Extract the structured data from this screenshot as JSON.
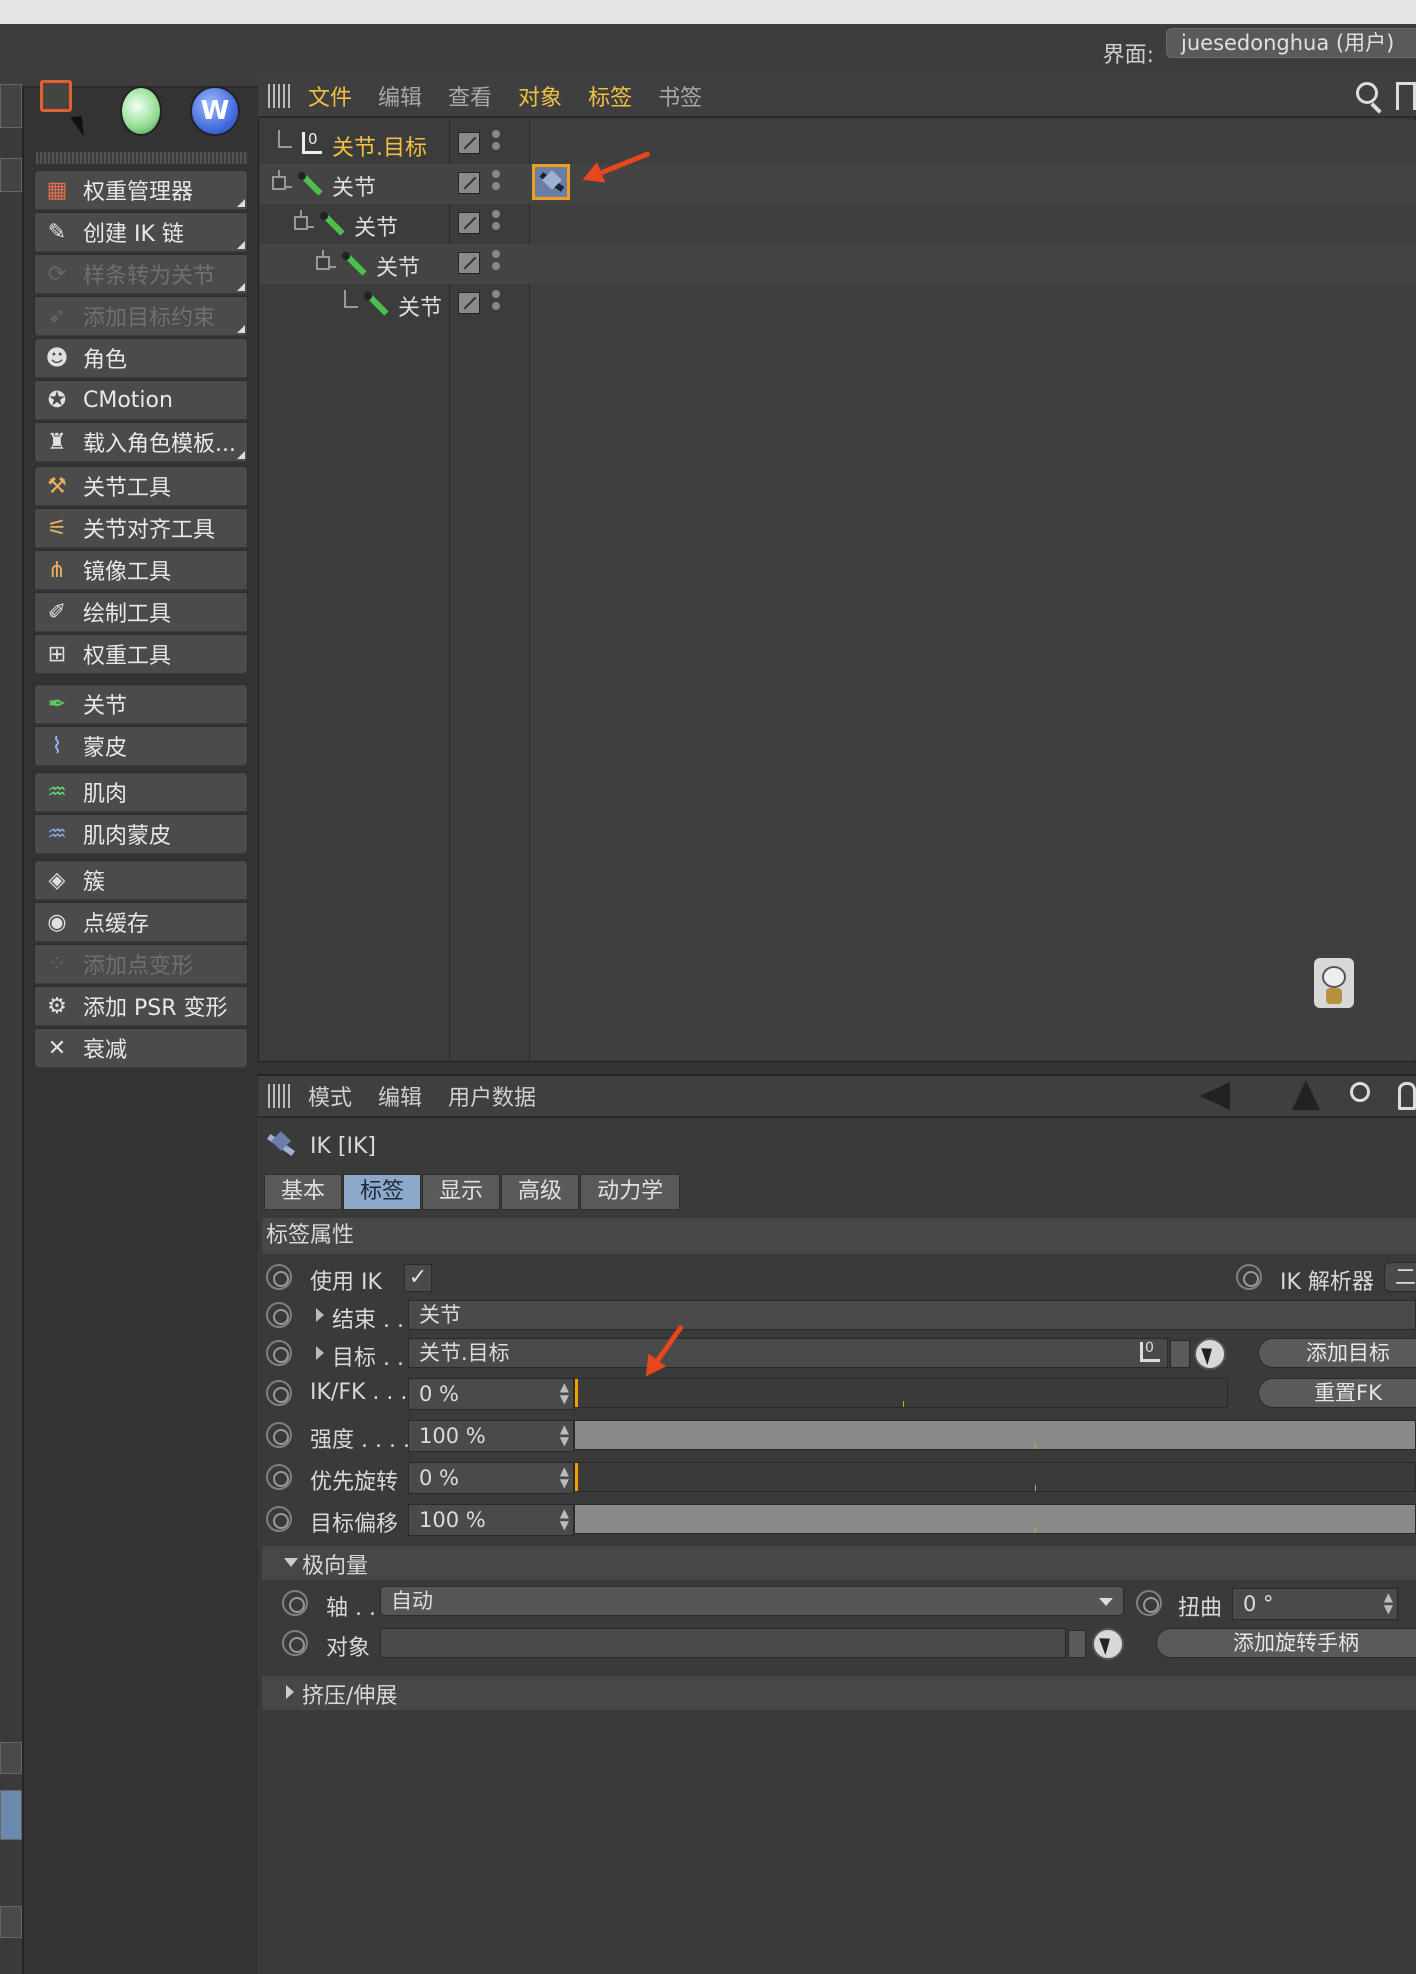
{
  "top_bar": {
    "interface_label": "界面:",
    "interface_value": "juesedonghua (用户)"
  },
  "tool_panel": {
    "groups": [
      [
        {
          "label": "权重管理器",
          "icon": "weight-manager-icon",
          "enabled": true,
          "has_submenu": true
        },
        {
          "label": "创建 IK 链",
          "icon": "create-ik-chain-icon",
          "enabled": true,
          "has_submenu": true
        },
        {
          "label": "样条转为关节",
          "icon": "spline-to-joint-icon",
          "enabled": false,
          "has_submenu": true
        },
        {
          "label": "添加目标约束",
          "icon": "target-constraint-icon",
          "enabled": false,
          "has_submenu": true
        }
      ],
      [
        {
          "label": "角色",
          "icon": "character-icon",
          "enabled": true
        },
        {
          "label": "CMotion",
          "icon": "cmotion-icon",
          "enabled": true
        },
        {
          "label": "载入角色模板...",
          "icon": "load-template-icon",
          "enabled": true,
          "has_submenu": true
        }
      ],
      [
        {
          "label": "关节工具",
          "icon": "joint-tool-icon",
          "enabled": true
        },
        {
          "label": "关节对齐工具",
          "icon": "joint-align-icon",
          "enabled": true
        },
        {
          "label": "镜像工具",
          "icon": "mirror-tool-icon",
          "enabled": true
        },
        {
          "label": "绘制工具",
          "icon": "paint-tool-icon",
          "enabled": true
        },
        {
          "label": "权重工具",
          "icon": "weight-tool-icon",
          "enabled": true
        }
      ],
      [
        {
          "label": "关节",
          "icon": "joint-icon",
          "enabled": true
        },
        {
          "label": "蒙皮",
          "icon": "skin-icon",
          "enabled": true
        }
      ],
      [
        {
          "label": "肌肉",
          "icon": "muscle-icon",
          "enabled": true
        },
        {
          "label": "肌肉蒙皮",
          "icon": "muscle-skin-icon",
          "enabled": true
        }
      ],
      [
        {
          "label": "簇",
          "icon": "cluster-icon",
          "enabled": true
        },
        {
          "label": "点缓存",
          "icon": "point-cache-icon",
          "enabled": true
        },
        {
          "label": "添加点变形",
          "icon": "pose-morph-icon",
          "enabled": false
        },
        {
          "label": "添加 PSR 变形",
          "icon": "psr-morph-icon",
          "enabled": true
        },
        {
          "label": "衰减",
          "icon": "falloff-icon",
          "enabled": true
        }
      ]
    ]
  },
  "object_manager": {
    "menu": [
      {
        "label": "文件",
        "highlight": true
      },
      {
        "label": "编辑",
        "highlight": false
      },
      {
        "label": "查看",
        "highlight": false
      },
      {
        "label": "对象",
        "highlight": true
      },
      {
        "label": "标签",
        "highlight": true
      },
      {
        "label": "书签",
        "highlight": false
      }
    ],
    "tree": [
      {
        "label": "关节.目标",
        "depth": 0,
        "type": "null",
        "target": true
      },
      {
        "label": "关节",
        "depth": 0,
        "type": "joint",
        "has_ik_tag": true
      },
      {
        "label": "关节",
        "depth": 1,
        "type": "joint"
      },
      {
        "label": "关节",
        "depth": 2,
        "type": "joint"
      },
      {
        "label": "关节",
        "depth": 3,
        "type": "joint"
      }
    ]
  },
  "attribute_manager": {
    "menu": [
      "模式",
      "编辑",
      "用户数据"
    ],
    "title": "IK [IK]",
    "tabs": [
      {
        "label": "基本",
        "active": false
      },
      {
        "label": "标签",
        "active": true
      },
      {
        "label": "显示",
        "active": false
      },
      {
        "label": "高级",
        "active": false
      },
      {
        "label": "动力学",
        "active": false
      }
    ],
    "section_title": "标签属性",
    "use_ik_label": "使用 IK",
    "use_ik_checked": true,
    "ik_solver_label": "IK 解析器",
    "ik_solver_value": "二",
    "end_label": "结束 . .",
    "end_value": "关节",
    "target_label": "目标 . .",
    "target_value": "关节.目标",
    "add_target_button": "添加目标",
    "reset_fk_button": "重置FK",
    "ikfk": {
      "label": "IK/FK . . .",
      "value": "0 %",
      "fraction": 0.0
    },
    "strength": {
      "label": "强度 . . . .",
      "value": "100 %",
      "fraction": 1.0
    },
    "rotation_priority": {
      "label": "优先旋转",
      "value": "0 %",
      "fraction": 0.0
    },
    "target_offset": {
      "label": "目标偏移",
      "value": "100 %",
      "fraction": 1.0
    },
    "pole_section": "极向量",
    "axis_label": "轴 . .",
    "axis_value": "自动",
    "twist_label": "扭曲",
    "twist_value": "0 °",
    "object_label": "对象",
    "object_value": "",
    "add_rotation_handle_button": "添加旋转手柄",
    "squash_section": "挤压/伸展"
  },
  "colors": {
    "highlight_text": "#f0c040",
    "active_tab": "#8da8c8",
    "annotation_arrow": "#e8461c"
  }
}
